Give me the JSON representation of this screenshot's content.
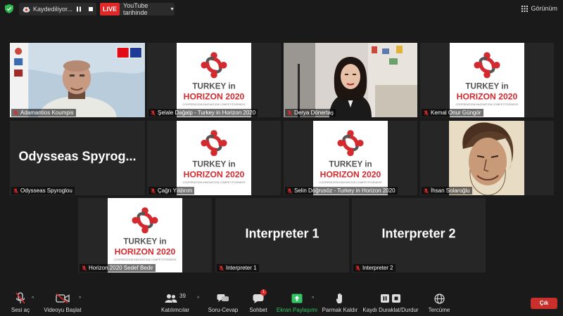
{
  "topbar": {
    "recording_label": "Kaydediliyor...",
    "live_badge": "LIVE",
    "live_target": "YouTube tarihinde",
    "view_label": "Görünüm"
  },
  "participants": [
    {
      "name": "Adamantios Koumpis",
      "type": "video-man",
      "active": true
    },
    {
      "name": "Şelale Dağalp - Turkey in Horizon 2020",
      "type": "logo"
    },
    {
      "name": "Derya Dönertaş",
      "type": "video-woman"
    },
    {
      "name": "Kemal Onur Güngör",
      "type": "logo"
    },
    {
      "name": "Odysseas Spyroglou",
      "type": "text",
      "display_text": "Odysseas  Spyrog..."
    },
    {
      "name": "Çağrı Yıldırım",
      "type": "logo"
    },
    {
      "name": "Selin Doğrusöz - Turkey in Horizon 2020",
      "type": "logo"
    },
    {
      "name": "İhsan Solaroğlu",
      "type": "portrait"
    },
    {
      "name": "Horizon 2020 Sedef Bedir",
      "type": "logo"
    },
    {
      "name": "Interpreter 1",
      "type": "text",
      "display_text": "Interpreter 1"
    },
    {
      "name": "Interpreter 2",
      "type": "text",
      "display_text": "Interpreter 2"
    }
  ],
  "logo_text": {
    "line1": "TURKEY",
    "line1_small": "in",
    "line2": "HORIZON 2020",
    "line3": "COOPERATION INNOVATION COMPETITIVENESS"
  },
  "toolbar": {
    "mute_label": "Sesi aç",
    "video_label": "Videoyu Başlat",
    "participants_label": "Katılımcılar",
    "participants_count": "39",
    "qa_label": "Soru-Cevap",
    "chat_label": "Sohbet",
    "chat_badge": "1",
    "share_label": "Ekran Paylaşımı",
    "raise_hand_label": "Parmak Kaldır",
    "record_label": "Kaydı Duraklat/Durdur",
    "translate_label": "Tercüme",
    "leave_label": "Çık"
  },
  "colors": {
    "background": "#1a1a1a",
    "tile": "#262626",
    "active_border": "#c7e03f",
    "live_red": "#e02828",
    "leave_red": "#c9302c",
    "share_green": "#33c463",
    "logo_red": "#d32a2f"
  }
}
